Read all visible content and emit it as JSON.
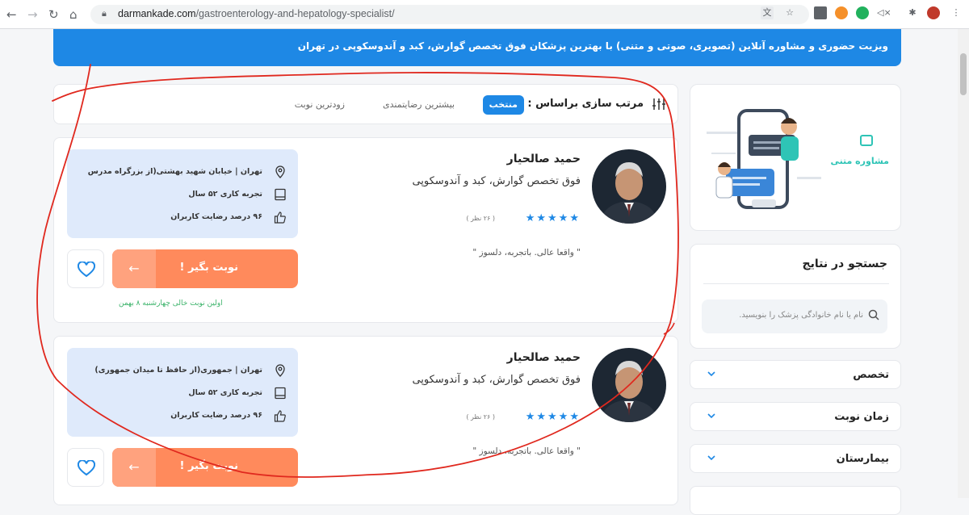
{
  "browser": {
    "url_host": "darmankade.com",
    "url_path": "/gastroenterology-and-hepatology-specialist/"
  },
  "banner": {
    "text": "ویزیت حضوری و مشاوره آنلاین (تصویری، صوتی و متنی) با بهترین پزشکان فوق تخصص گوارش، کبد و آندوسکوپی در تهران"
  },
  "sidebar": {
    "consult_label": "مشاوره متنی",
    "search": {
      "title": "جستجو در نتایج",
      "placeholder": "نام یا نام خانوادگی پزشک را بنویسید."
    },
    "filters": [
      {
        "label": "تخصص"
      },
      {
        "label": "زمان نوبت"
      },
      {
        "label": "بیمارستان"
      }
    ]
  },
  "sort": {
    "title": "مرتب سازی براساس :",
    "options": [
      {
        "label": "منتخب",
        "active": true
      },
      {
        "label": "بیشترین رضایتمندی",
        "active": false
      },
      {
        "label": "زودترین نوبت",
        "active": false
      }
    ]
  },
  "doctors": [
    {
      "name": "حمید صالحیار",
      "specialty": "فوق تخصص گوارش، کبد و آندوسکوپی",
      "rating": 5,
      "reviews": "( ۲۶ نظر )",
      "quote": "\" واقعا عالی. باتجربه، دلسوز \"",
      "address": "تهران | خیابان شهید بهشتی(از بزرگراه مدرس",
      "experience": "تجربه کاری ۵۲ سال",
      "satisfaction": "۹۶ درصد رضایت کاربران",
      "book_label": "نوبت بگیر !",
      "first_slot": "اولین نوبت خالی چهارشنبه ۸ بهمن"
    },
    {
      "name": "حمید صالحیار",
      "specialty": "فوق تخصص گوارش، کبد و آندوسکوپی",
      "rating": 5,
      "reviews": "( ۲۶ نظر )",
      "quote": "\" واقعا عالی. باتجربه، دلسوز \"",
      "address": "تهران | جمهوری(از حافظ تا میدان جمهوری)",
      "experience": "تجربه کاری ۵۲ سال",
      "satisfaction": "۹۶ درصد رضایت کاربران",
      "book_label": "نوبت بگیر !"
    }
  ],
  "colors": {
    "primary": "#1e88e5",
    "accent": "#ff8a5c",
    "teal": "#2ec4b6",
    "annotation": "#e0281e"
  }
}
